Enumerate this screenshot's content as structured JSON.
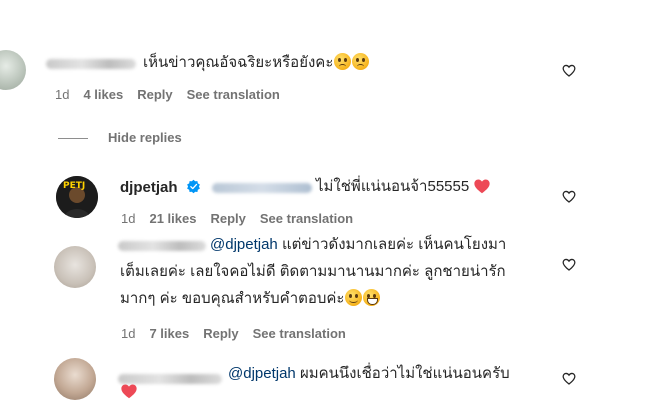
{
  "comments": [
    {
      "text": "เห็นข่าวคุณอัจฉริยะหรือยังคะ",
      "meta": {
        "time": "1d",
        "likes": "4 likes",
        "reply": "Reply",
        "translate": "See translation"
      }
    },
    {
      "hide_replies": "Hide replies"
    },
    {
      "username": "djpetjah",
      "text": "ไม่ใช่พี่แน่นอนจ้า55555",
      "meta": {
        "time": "1d",
        "likes": "21 likes",
        "reply": "Reply",
        "translate": "See translation"
      }
    },
    {
      "mention": "@djpetjah",
      "line1": "แต่ข่าวดังมากเลยค่ะ เห็นคนโยงมา",
      "line2": "เต็มเลยค่ะ เลยใจคอไม่ดี ติดตามมานานมากค่ะ ลูกชายน่ารัก",
      "line3": "มากๆ ค่ะ ขอบคุณสำหรับคำตอบค่ะ",
      "meta": {
        "time": "1d",
        "likes": "7 likes",
        "reply": "Reply",
        "translate": "See translation"
      }
    },
    {
      "mention": "@djpetjah",
      "text": "ผมคนนึงเชื่อว่าไม่ใช่แน่นอนครับ"
    }
  ],
  "colors": {
    "mention": "#00376b",
    "meta": "#737373",
    "verified": "#0095f6",
    "heart": "#ed4956"
  }
}
